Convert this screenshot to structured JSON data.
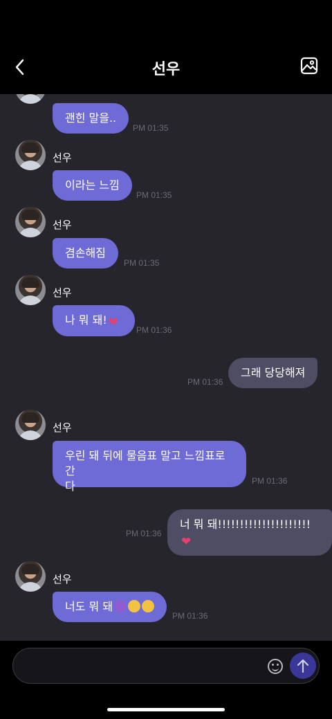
{
  "header": {
    "title": "선우",
    "back_icon": "chevron-left-icon",
    "gallery_icon": "image-icon"
  },
  "messages": [
    {
      "sender": "",
      "text": "괜힌 말을..",
      "time": "PM 01:35",
      "direction": "in"
    },
    {
      "sender": "선우",
      "text": "이라는 느낌",
      "time": "PM 01:35",
      "direction": "in"
    },
    {
      "sender": "선우",
      "text": "겸손해짐",
      "time": "PM 01:35",
      "direction": "in"
    },
    {
      "sender": "선우",
      "text": "나 뭐 돼!",
      "emoji": [
        "heart"
      ],
      "time": "PM 01:36",
      "direction": "in"
    },
    {
      "text": "그래 당당해져",
      "time": "PM 01:36",
      "direction": "out"
    },
    {
      "sender": "선우",
      "text": "우린 돼 뒤에 물음표 말고 느낌표로 간다",
      "line1": "우린 돼 뒤에 물음표 말고 느낌표로 간",
      "line2": "다",
      "time": "PM 01:36",
      "direction": "in"
    },
    {
      "text": "너 뭐 돼!!!!!!!!!!!!!!!!!!!!!",
      "emoji": [
        "heart"
      ],
      "time": "PM 01:36",
      "direction": "out"
    },
    {
      "sender": "선우",
      "text": "너도 뭐 돼",
      "emoji": [
        "devil",
        "blush",
        "blush"
      ],
      "time": "PM 01:36",
      "direction": "in"
    }
  ],
  "composer": {
    "placeholder": "",
    "emoji_icon": "smiley-icon",
    "send_icon": "arrow-up-icon"
  },
  "colors": {
    "incoming_bubble": "#6f6bd6",
    "outgoing_bubble": "#4e4d63",
    "chat_background": "#25252b",
    "send_button": "#3a3799"
  }
}
